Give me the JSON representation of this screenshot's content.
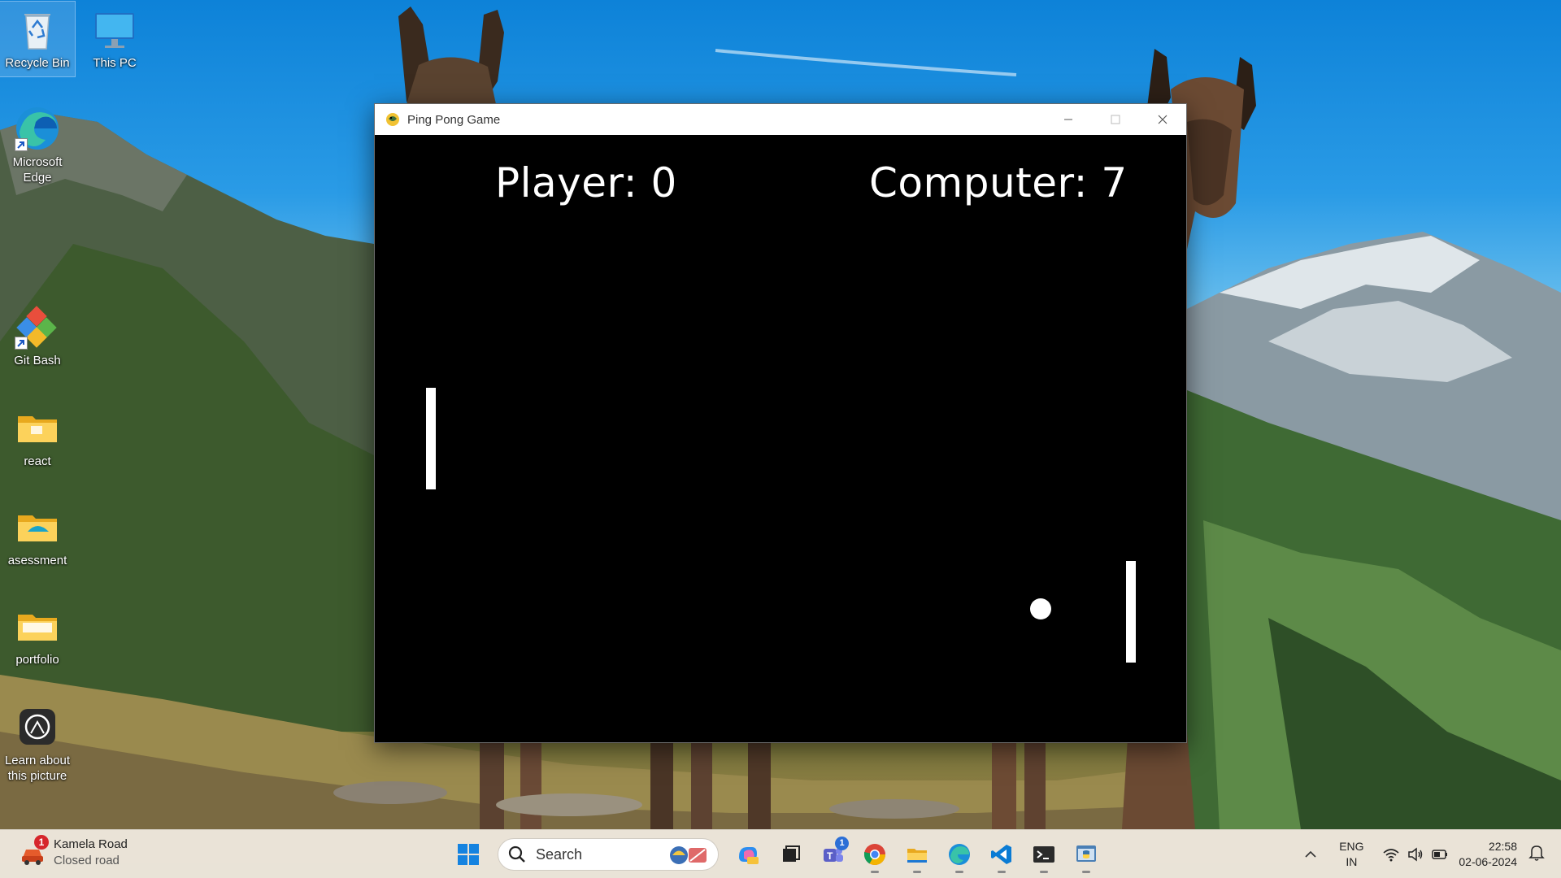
{
  "desktop": {
    "icons": [
      {
        "label": "Recycle Bin",
        "icon": "recycle-bin-icon"
      },
      {
        "label": "This PC",
        "icon": "monitor-icon"
      },
      {
        "label": "Microsoft Edge",
        "icon": "edge-icon"
      },
      {
        "label": "Git Bash",
        "icon": "git-bash-icon"
      },
      {
        "label": "react",
        "icon": "folder-icon"
      },
      {
        "label": "asessment",
        "icon": "folder-icon"
      },
      {
        "label": "portfolio",
        "icon": "folder-icon"
      },
      {
        "label": "Learn about this picture",
        "icon": "camera-icon"
      }
    ]
  },
  "window": {
    "title": "Ping Pong Game",
    "controls": {
      "minimize": "minimize",
      "maximize": "maximize",
      "close": "close"
    }
  },
  "game": {
    "player_score_label": "Player: 0",
    "computer_score_label": "Computer: 7",
    "player_score": 0,
    "computer_score": 7
  },
  "taskbar": {
    "weather": {
      "title": "Kamela Road",
      "subtitle": "Closed road",
      "badge": "1"
    },
    "search_placeholder": "Search",
    "apps": [
      {
        "name": "start",
        "icon": "windows-start-icon"
      },
      {
        "name": "copilot",
        "icon": "copilot-icon"
      },
      {
        "name": "task-view",
        "icon": "task-view-icon"
      },
      {
        "name": "teams",
        "icon": "teams-icon",
        "badge": "1"
      },
      {
        "name": "chrome",
        "icon": "chrome-icon"
      },
      {
        "name": "file-explorer",
        "icon": "folder-icon"
      },
      {
        "name": "edge",
        "icon": "edge-icon"
      },
      {
        "name": "vscode",
        "icon": "vscode-icon"
      },
      {
        "name": "terminal",
        "icon": "terminal-icon"
      },
      {
        "name": "python",
        "icon": "python-icon"
      }
    ],
    "tray": {
      "language_top": "ENG",
      "language_bottom": "IN",
      "time": "22:58",
      "date": "02-06-2024"
    }
  },
  "colors": {
    "taskbar_bg": "#eee8de",
    "game_bg": "#000000",
    "game_fg": "#ffffff"
  }
}
